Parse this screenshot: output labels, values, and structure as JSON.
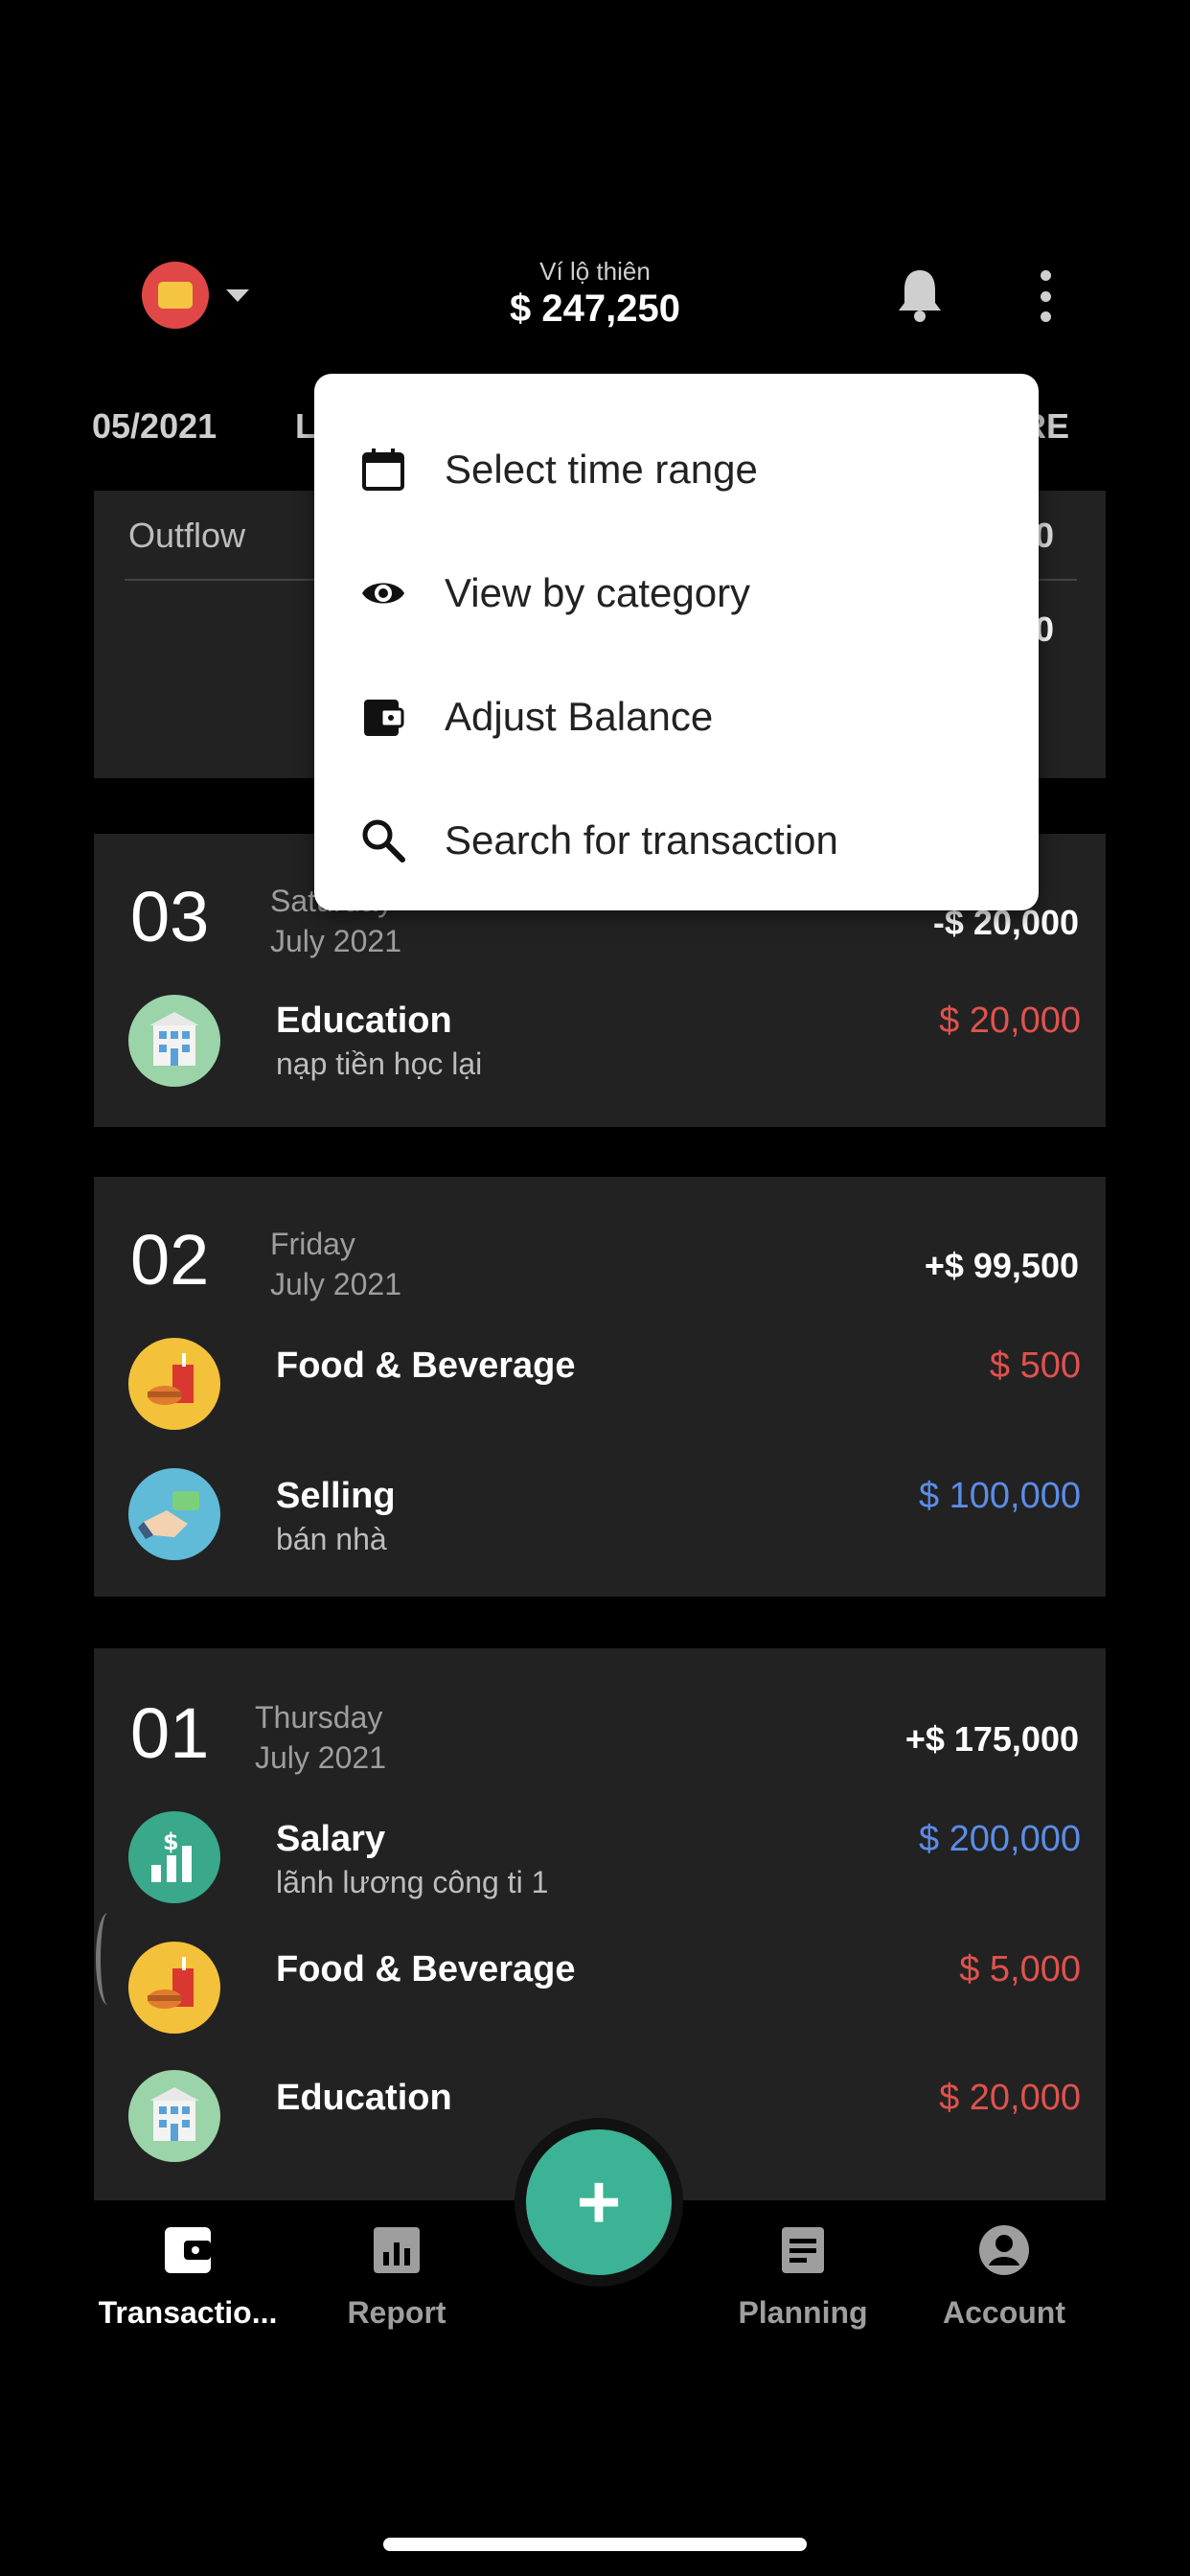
{
  "header": {
    "wallet_name": "Ví lộ thiên",
    "wallet_balance": "$ 247,250"
  },
  "date_tabs": {
    "left": "05/2021",
    "middle": "L",
    "right": "RE"
  },
  "summary": {
    "outflow_label": "Outflow",
    "value_1": "00",
    "value_2": "00"
  },
  "days": [
    {
      "day": "03",
      "weekday": "Saturday",
      "month": "July 2021",
      "total": "-$ 20,000",
      "transactions": [
        {
          "category": "Education",
          "note": "nạp tiền học lại",
          "amount": "$ 20,000",
          "icon": "school-building-icon"
        }
      ]
    },
    {
      "day": "02",
      "weekday": "Friday",
      "month": "July 2021",
      "total": "+$ 99,500",
      "transactions": [
        {
          "category": "Food & Beverage",
          "note": "",
          "amount": "$ 500",
          "icon": "food-drink-icon"
        },
        {
          "category": "Selling",
          "note": "bán nhà",
          "amount": "$ 100,000",
          "icon": "handshake-money-icon"
        }
      ]
    },
    {
      "day": "01",
      "weekday": "Thursday",
      "month": "July 2021",
      "total": "+$ 175,000",
      "transactions": [
        {
          "category": "Salary",
          "note": "lãnh lương công ti 1",
          "amount": "$ 200,000",
          "icon": "salary-chart-icon"
        },
        {
          "category": "Food & Beverage",
          "note": "",
          "amount": "$ 5,000",
          "icon": "food-drink-icon"
        },
        {
          "category": "Education",
          "note": "",
          "amount": "$ 20,000",
          "icon": "school-building-icon"
        }
      ]
    }
  ],
  "menu": {
    "items": [
      {
        "label": "Select time range",
        "icon": "calendar-icon"
      },
      {
        "label": "View by category",
        "icon": "eye-icon"
      },
      {
        "label": "Adjust Balance",
        "icon": "wallet-icon"
      },
      {
        "label": "Search for transaction",
        "icon": "search-icon"
      }
    ]
  },
  "nav": {
    "transactions": "Transactio...",
    "report": "Report",
    "planning": "Planning",
    "account": "Account",
    "fab": "+"
  },
  "colors": {
    "negative": "#e0524e",
    "positive": "#5b8de8",
    "accent": "#3bb394"
  }
}
